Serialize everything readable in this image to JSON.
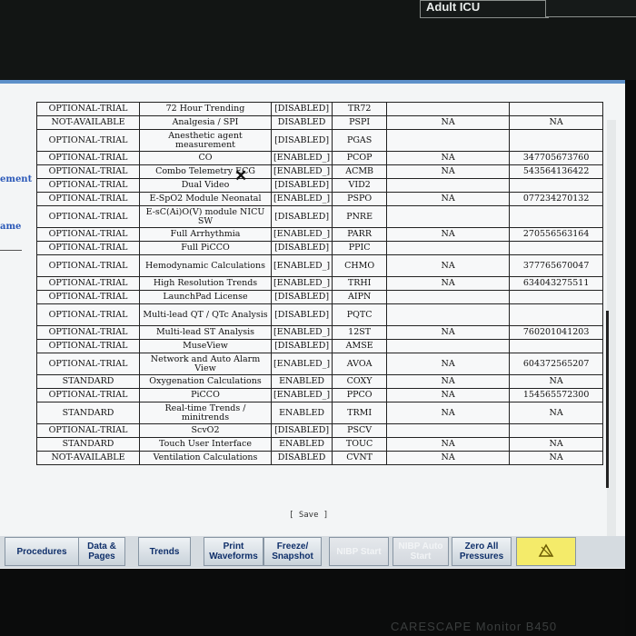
{
  "header": {
    "unit_label": "Adult ICU"
  },
  "left_panel": {
    "label_1": "ement",
    "label_2": "ame"
  },
  "cursor_glyph": "✕",
  "table": {
    "rows": [
      [
        "OPTIONAL-TRIAL",
        "72 Hour Trending",
        "[DISABLED]",
        "TR72",
        "",
        ""
      ],
      [
        "NOT-AVAILABLE",
        "Analgesia / SPI",
        "DISABLED",
        "PSPI",
        "NA",
        "NA"
      ],
      [
        "OPTIONAL-TRIAL",
        "Anesthetic agent measurement",
        "[DISABLED]",
        "PGAS",
        "",
        ""
      ],
      [
        "OPTIONAL-TRIAL",
        "CO",
        "[ENABLED_]",
        "PCOP",
        "NA",
        "347705673760"
      ],
      [
        "OPTIONAL-TRIAL",
        "Combo Telemetry ECG",
        "[ENABLED_]",
        "ACMB",
        "NA",
        "543564136422"
      ],
      [
        "OPTIONAL-TRIAL",
        "Dual Video",
        "[DISABLED]",
        "VID2",
        "",
        ""
      ],
      [
        "OPTIONAL-TRIAL",
        "E-SpO2 Module Neonatal",
        "[ENABLED_]",
        "PSPO",
        "NA",
        "077234270132"
      ],
      [
        "OPTIONAL-TRIAL",
        "E-sC(Ai)O(V) module NICU SW",
        "[DISABLED]",
        "PNRE",
        "",
        ""
      ],
      [
        "OPTIONAL-TRIAL",
        "Full Arrhythmia",
        "[ENABLED_]",
        "PARR",
        "NA",
        "270556563164"
      ],
      [
        "OPTIONAL-TRIAL",
        "Full PiCCO",
        "[DISABLED]",
        "PPIC",
        "",
        ""
      ],
      [
        "OPTIONAL-TRIAL",
        "Hemodynamic Calculations",
        "[ENABLED_]",
        "CHMO",
        "NA",
        "377765670047"
      ],
      [
        "OPTIONAL-TRIAL",
        "High Resolution Trends",
        "[ENABLED_]",
        "TRHI",
        "NA",
        "634043275511"
      ],
      [
        "OPTIONAL-TRIAL",
        "LaunchPad License",
        "[DISABLED]",
        "AIPN",
        "",
        ""
      ],
      [
        "OPTIONAL-TRIAL",
        "Multi-lead QT / QTc Analysis",
        "[DISABLED]",
        "PQTC",
        "",
        ""
      ],
      [
        "OPTIONAL-TRIAL",
        "Multi-lead ST Analysis",
        "[ENABLED_]",
        "12ST",
        "NA",
        "760201041203"
      ],
      [
        "OPTIONAL-TRIAL",
        "MuseView",
        "[DISABLED]",
        "AMSE",
        "",
        ""
      ],
      [
        "OPTIONAL-TRIAL",
        "Network and Auto Alarm View",
        "[ENABLED_]",
        "AVOA",
        "NA",
        "604372565207"
      ],
      [
        "STANDARD",
        "Oxygenation Calculations",
        "ENABLED",
        "COXY",
        "NA",
        "NA"
      ],
      [
        "OPTIONAL-TRIAL",
        "PiCCO",
        "[ENABLED_]",
        "PPCO",
        "NA",
        "154565572300"
      ],
      [
        "STANDARD",
        "Real-time Trends / minitrends",
        "ENABLED",
        "TRMI",
        "NA",
        "NA"
      ],
      [
        "OPTIONAL-TRIAL",
        "ScvO2",
        "[DISABLED]",
        "PSCV",
        "",
        ""
      ],
      [
        "STANDARD",
        "Touch User Interface",
        "ENABLED",
        "TOUC",
        "NA",
        "NA"
      ],
      [
        "NOT-AVAILABLE",
        "Ventilation Calculations",
        "DISABLED",
        "CVNT",
        "NA",
        "NA"
      ]
    ],
    "two_line": [
      2,
      7,
      10,
      13,
      16,
      19
    ]
  },
  "save_label": "[ Save ]",
  "bottom_buttons": [
    {
      "label": "Procedures",
      "enabled": true
    },
    {
      "label": "Data & Pages",
      "enabled": true
    },
    {
      "label": "Trends",
      "enabled": true
    },
    {
      "label": "Print Waveforms",
      "enabled": true
    },
    {
      "label": "Freeze/ Snapshot",
      "enabled": true
    },
    {
      "label": "NIBP Start",
      "enabled": false
    },
    {
      "label": "NIBP Auto Start",
      "enabled": false
    },
    {
      "label": "Zero All Pressures",
      "enabled": true
    },
    {
      "label": "alarm-silence-icon",
      "enabled": true
    }
  ],
  "brand": "CARESCAPE Monitor B450"
}
